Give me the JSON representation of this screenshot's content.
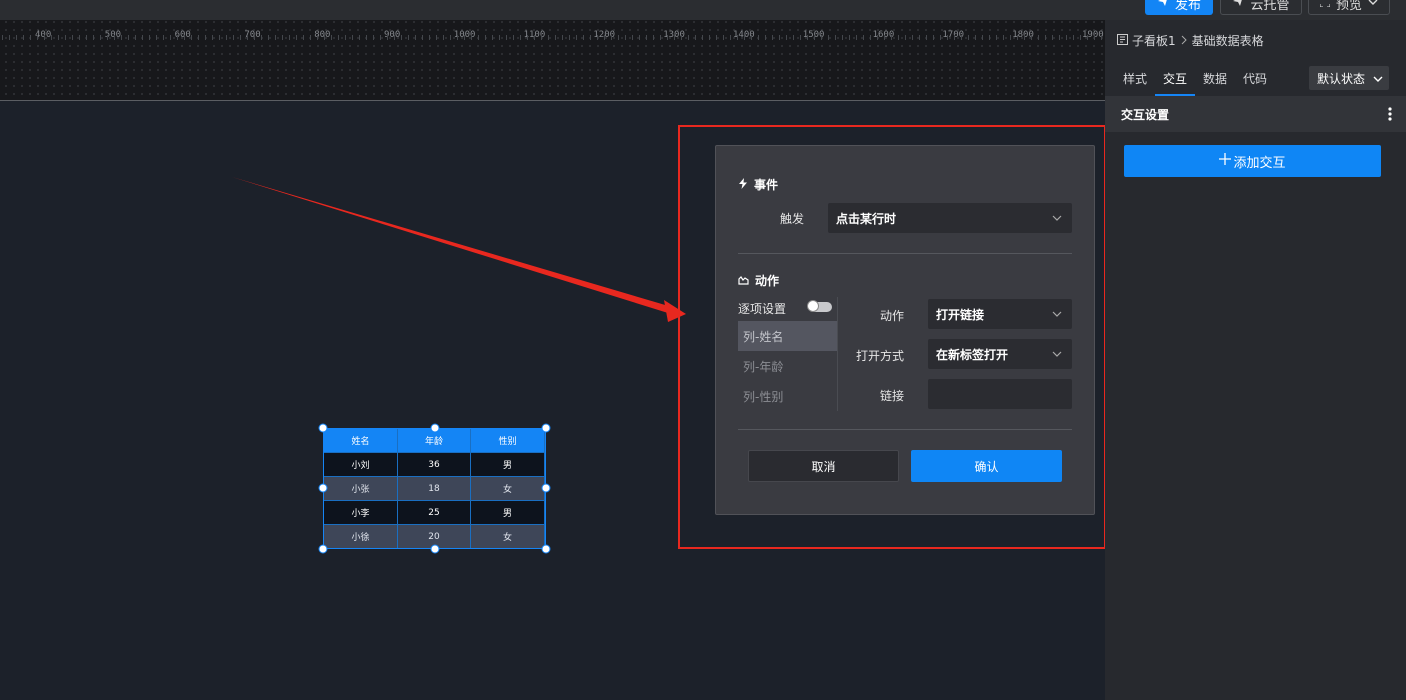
{
  "toolbar": {
    "publish_label": "发布",
    "cloud_label": "云托管",
    "preview_label": "预览"
  },
  "ruler": {
    "labels": [
      "400",
      "500",
      "600",
      "700",
      "800",
      "900",
      "1000",
      "1100",
      "1200",
      "1300",
      "1400",
      "1500",
      "1600",
      "1700",
      "1800",
      "1900"
    ]
  },
  "table_widget": {
    "headers": [
      "姓名",
      "年龄",
      "性别"
    ],
    "rows": [
      [
        "小刘",
        "36",
        "男"
      ],
      [
        "小张",
        "18",
        "女"
      ],
      [
        "小李",
        "25",
        "男"
      ],
      [
        "小徐",
        "20",
        "女"
      ]
    ]
  },
  "dialog": {
    "event_title": "事件",
    "trigger_label": "触发",
    "trigger_value": "点击某行时",
    "action_title": "动作",
    "per_item_label": "逐项设置",
    "columns": [
      "列-姓名",
      "列-年龄",
      "列-性别"
    ],
    "action_label": "动作",
    "action_value": "打开链接",
    "open_mode_label": "打开方式",
    "open_mode_value": "在新标签打开",
    "link_label": "链接",
    "link_value": "",
    "cancel_label": "取消",
    "confirm_label": "确认"
  },
  "right_panel": {
    "breadcrumb_parent": "子看板1",
    "breadcrumb_current": "基础数据表格",
    "tabs": [
      "样式",
      "交互",
      "数据",
      "代码"
    ],
    "active_tab": "交互",
    "state_select": "默认状态",
    "section_title": "交互设置",
    "add_interaction_label": "添加交互"
  },
  "colors": {
    "accent": "#1585f6",
    "highlight_red": "#e8281f",
    "canvas_bg": "#1c212a",
    "panel_bg": "#27292e"
  }
}
